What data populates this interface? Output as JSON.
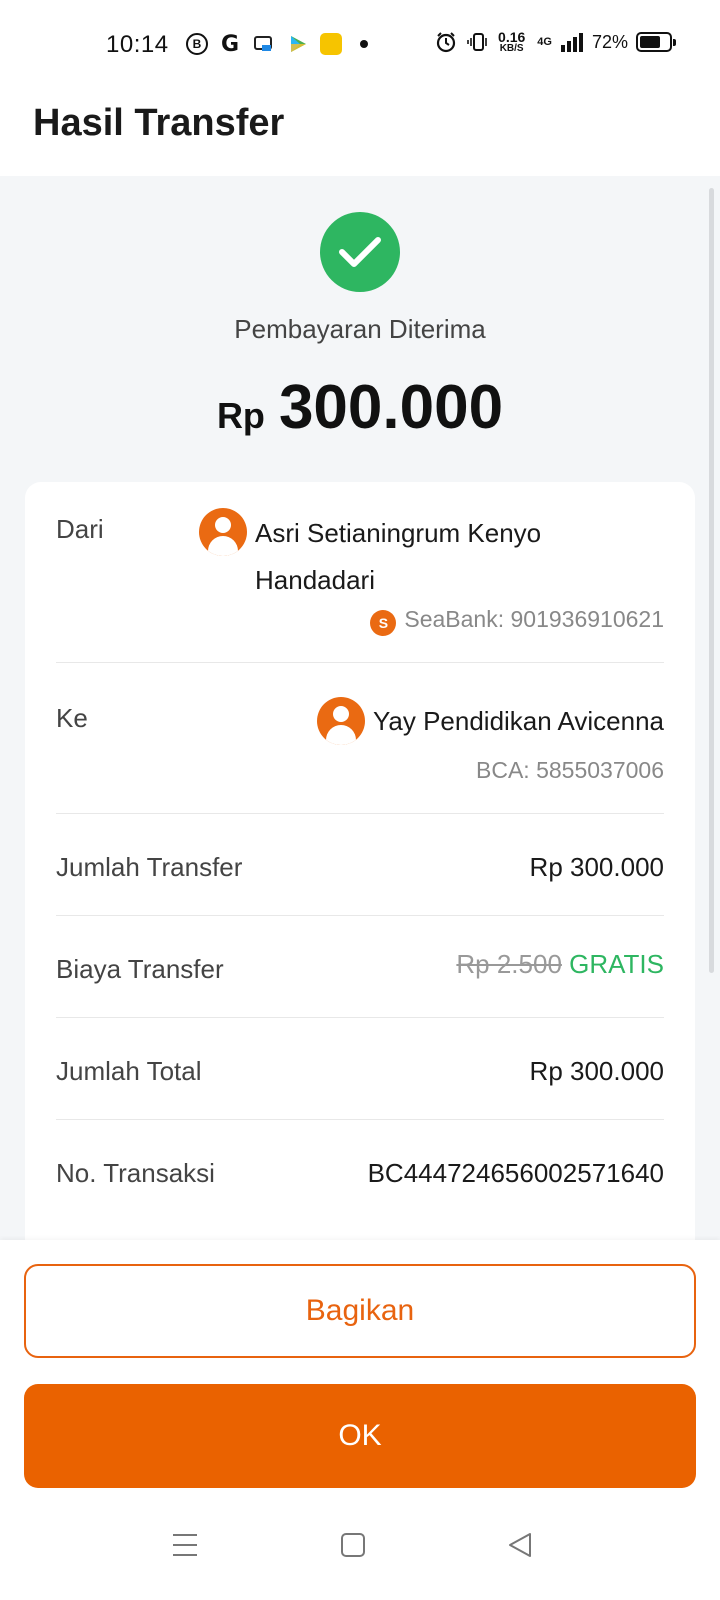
{
  "status_bar": {
    "time": "10:14",
    "net_speed_value": "0.16",
    "net_speed_unit": "KB/S",
    "network": "4G",
    "battery": "72%",
    "battery_level": 0.72,
    "icons_left": [
      "b-circle-icon",
      "g-icon",
      "wps-icon",
      "play-icon",
      "app-yellow-icon",
      "dot-icon"
    ],
    "icons_right": [
      "alarm-icon",
      "vibrate-icon",
      "signal-icon",
      "battery-icon"
    ]
  },
  "header": {
    "title": "Hasil Transfer"
  },
  "result": {
    "status": "Pembayaran Diterima",
    "currency": "Rp",
    "amount": "300.000",
    "accent_color": "#2eb661"
  },
  "details": {
    "from_label": "Dari",
    "from_name_line1": "Asri Setianingrum Kenyo",
    "from_name_line2": "Handadari",
    "from_account": "SeaBank: 901936910621",
    "to_label": "Ke",
    "to_name": "Yay Pendidikan Avicenna",
    "to_account": "BCA: 5855037006",
    "transfer_amount_label": "Jumlah Transfer",
    "transfer_amount": "Rp 300.000",
    "fee_label": "Biaya Transfer",
    "fee_original": "Rp 2.500",
    "fee_value": "GRATIS",
    "total_label": "Jumlah Total",
    "total": "Rp 300.000",
    "txn_label": "No. Transaksi",
    "txn_id": "BC444724656002571640"
  },
  "actions": {
    "share_label": "Bagikan",
    "ok_label": "OK",
    "brand_color": "#ea6200"
  },
  "navbar": {
    "buttons": [
      "menu-icon",
      "home-icon",
      "back-icon"
    ]
  }
}
